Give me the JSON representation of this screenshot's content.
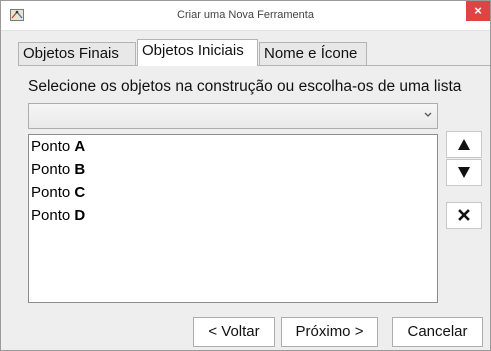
{
  "window": {
    "title": "Criar uma Nova Ferramenta",
    "close_symbol": "×"
  },
  "tabs": [
    {
      "label": "Objetos Finais",
      "selected": false
    },
    {
      "label": "Objetos Iniciais",
      "selected": true
    },
    {
      "label": "Nome e Ícone",
      "selected": false
    }
  ],
  "main": {
    "instruction": "Selecione os objetos na construção ou escolha-os de uma lista",
    "combo_value": "",
    "objects": [
      {
        "prefix": "Ponto ",
        "name": "A"
      },
      {
        "prefix": "Ponto ",
        "name": "B"
      },
      {
        "prefix": "Ponto ",
        "name": "C"
      },
      {
        "prefix": "Ponto ",
        "name": "D"
      }
    ]
  },
  "side_buttons": {
    "up_icon": "triangle-up-icon",
    "down_icon": "triangle-down-icon",
    "remove_icon": "x-icon"
  },
  "footer": {
    "back_label": "< Voltar",
    "next_label": "Próximo >",
    "cancel_label": "Cancelar"
  },
  "colors": {
    "close_button": "#e04343",
    "window_bg": "#eeeeee"
  }
}
